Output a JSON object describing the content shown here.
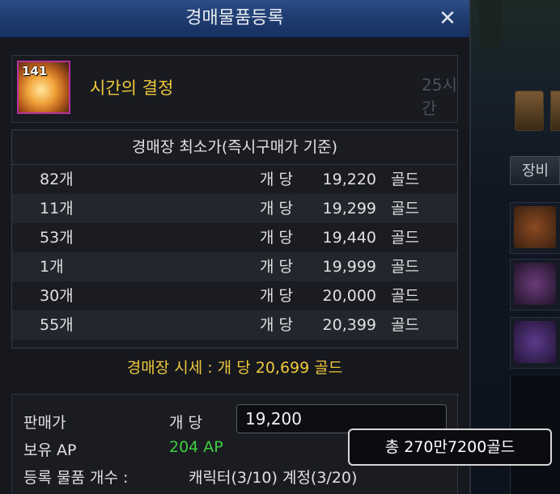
{
  "window": {
    "title": "경매물품등록",
    "close_glyph": "✕"
  },
  "item": {
    "name": "시간의 결정",
    "quantity_badge": "141",
    "duration": "25시간",
    "icon": "crystal-of-time-icon"
  },
  "price_table": {
    "header": "경매장 최소가(즉시구매가 기준)",
    "unit_label": "개 당",
    "currency": "골드",
    "rows": [
      {
        "count": "82개",
        "price": "19,220"
      },
      {
        "count": "11개",
        "price": "19,299"
      },
      {
        "count": "53개",
        "price": "19,440"
      },
      {
        "count": "1개",
        "price": "19,999"
      },
      {
        "count": "30개",
        "price": "20,000"
      },
      {
        "count": "55개",
        "price": "20,399"
      }
    ]
  },
  "market_price": "경매장 시세 : 개 당 20,699 골드",
  "sell": {
    "price_label": "판매가",
    "unit_label": "개 당",
    "price_value": "19,200",
    "ap_label": "보유 AP",
    "ap_value": "204 AP",
    "count_label": "등록 물품 개수 :",
    "count_value": "캐릭터(3/10) 계정(3/20)"
  },
  "tooltip": {
    "text": "총 270만7200골드"
  },
  "background": {
    "tab_label": "장비"
  },
  "colors": {
    "title_bar": "#1e3a6e",
    "gold_text": "#f0c83a",
    "ap_green": "#3fcf3f",
    "item_border": "#b7309c"
  }
}
